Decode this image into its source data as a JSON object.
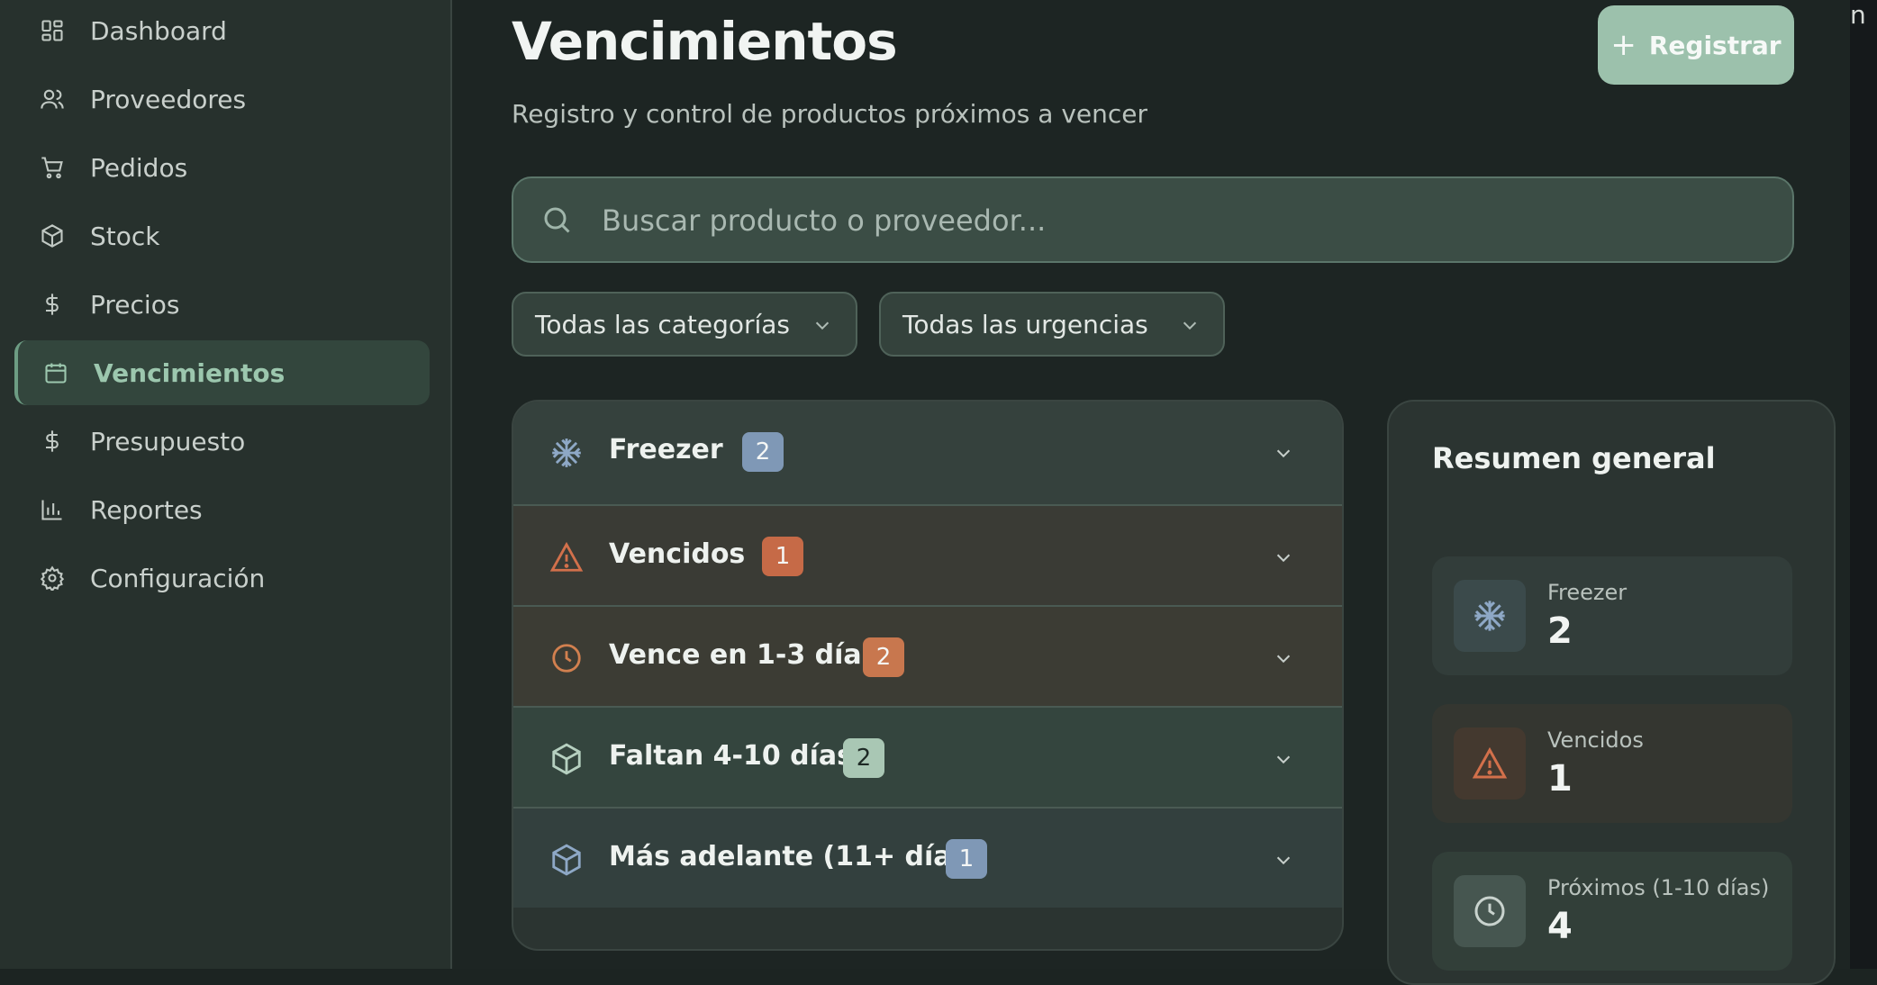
{
  "sidebar": {
    "items": [
      {
        "label": "Dashboard",
        "icon": "grid-icon"
      },
      {
        "label": "Proveedores",
        "icon": "users-icon"
      },
      {
        "label": "Pedidos",
        "icon": "cart-icon"
      },
      {
        "label": "Stock",
        "icon": "box-icon"
      },
      {
        "label": "Precios",
        "icon": "dollar-icon"
      },
      {
        "label": "Vencimientos",
        "icon": "calendar-icon",
        "active": true
      },
      {
        "label": "Presupuesto",
        "icon": "dollar-icon"
      },
      {
        "label": "Reportes",
        "icon": "bar-chart-icon"
      },
      {
        "label": "Configuración",
        "icon": "gear-icon"
      }
    ]
  },
  "header": {
    "title": "Vencimientos",
    "subtitle": "Registro y control de productos próximos a vencer",
    "register_label": "Registrar"
  },
  "search": {
    "placeholder": "Buscar producto o proveedor..."
  },
  "filters": {
    "category": "Todas las categorías",
    "urgency": "Todas las urgencias"
  },
  "groups": [
    {
      "label": "Freezer",
      "count": "2",
      "icon": "snowflake-icon",
      "color": "#7f98b6"
    },
    {
      "label": "Vencidos",
      "count": "1",
      "icon": "warning-icon",
      "color": "#c66a47"
    },
    {
      "label": "Vence en 1-3 días",
      "count": "2",
      "icon": "clock-icon",
      "color": "#c8774e"
    },
    {
      "label": "Faltan 4-10 días",
      "count": "2",
      "icon": "box-icon",
      "color": "#a9c7b4"
    },
    {
      "label": "Más adelante (11+ días)",
      "count": "1",
      "icon": "box-icon",
      "color": "#7f98b6"
    }
  ],
  "summary": {
    "title": "Resumen general",
    "stats": [
      {
        "label": "Freezer",
        "value": "2",
        "icon": "snowflake-icon"
      },
      {
        "label": "Vencidos",
        "value": "1",
        "icon": "warning-icon"
      },
      {
        "label": "Próximos (1-10 días)",
        "value": "4",
        "icon": "clock-icon"
      }
    ]
  },
  "edge_text": "n",
  "colors": {
    "accent": "#9cc1ac",
    "sidebar_bg": "#27312d",
    "main_bg": "#1d2523",
    "expired": "#c66a47",
    "soon": "#c8774e",
    "freezer": "#7f98b6"
  }
}
